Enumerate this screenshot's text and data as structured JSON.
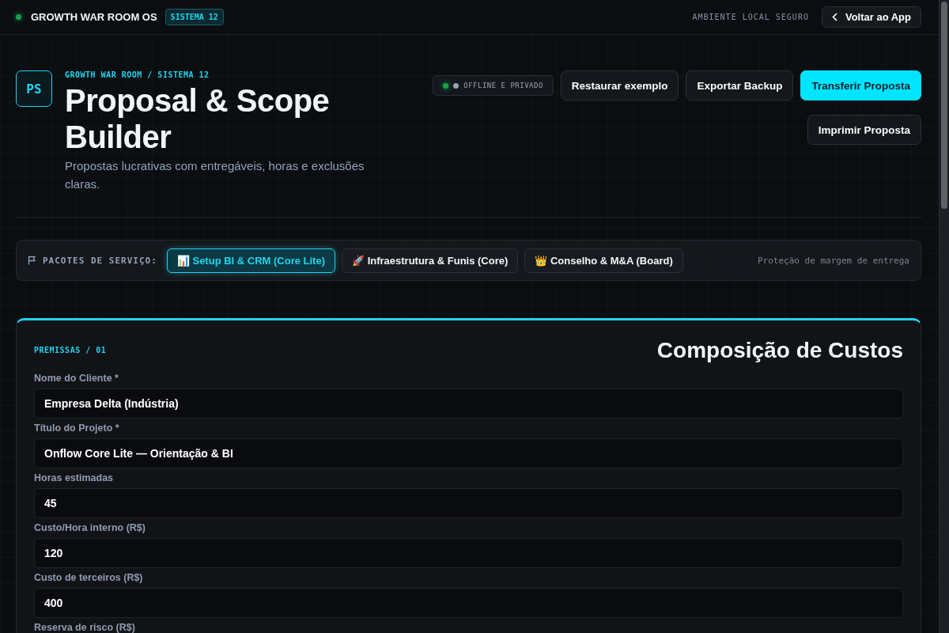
{
  "topbar": {
    "status_on": true,
    "brand": "GROWTH WAR ROOM OS",
    "badge": "SISTEMA 12",
    "env": "AMBIENTE LOCAL SEGURO",
    "back_button": "Voltar ao App"
  },
  "header": {
    "logo": "PS",
    "eyebrow": "GROWTH WAR ROOM / SISTEMA 12",
    "title": "Proposal & Scope Builder",
    "subtitle": "Propostas lucrativas com entregáveis, horas e exclusões claras.",
    "status": "OFFLINE E PRIVADO",
    "actions": [
      {
        "label": "Restaurar exemplo",
        "kind": "secondary"
      },
      {
        "label": "Exportar Backup",
        "kind": "secondary"
      },
      {
        "label": "Transferir Proposta",
        "kind": "primary"
      },
      {
        "label": "Imprimir Proposta",
        "kind": "secondary"
      }
    ]
  },
  "packages": {
    "label": "PACOTES DE SERVIÇO:",
    "items": [
      {
        "label": "📊 Setup BI & CRM (Core Lite)",
        "selected": true
      },
      {
        "label": "🚀 Infraestrutura & Funis (Core)",
        "selected": false
      },
      {
        "label": "👑 Conselho & M&A (Board)",
        "selected": false
      }
    ],
    "note": "Proteção de margem de entrega"
  },
  "card": {
    "eyebrow": "PREMISSAS / 01",
    "title": "Composição de Custos",
    "fields": [
      {
        "label": "Nome do Cliente *",
        "value": "Empresa Delta (Indústria)"
      },
      {
        "label": "Título do Projeto *",
        "value": "Onflow Core Lite — Orientação & BI"
      },
      {
        "label": "Horas estimadas",
        "value": "45"
      },
      {
        "label": "Custo/Hora interno (R$)",
        "value": "120"
      },
      {
        "label": "Custo de terceiros (R$)",
        "value": "400"
      },
      {
        "label": "Reserva de risco (R$)"
      }
    ]
  }
}
